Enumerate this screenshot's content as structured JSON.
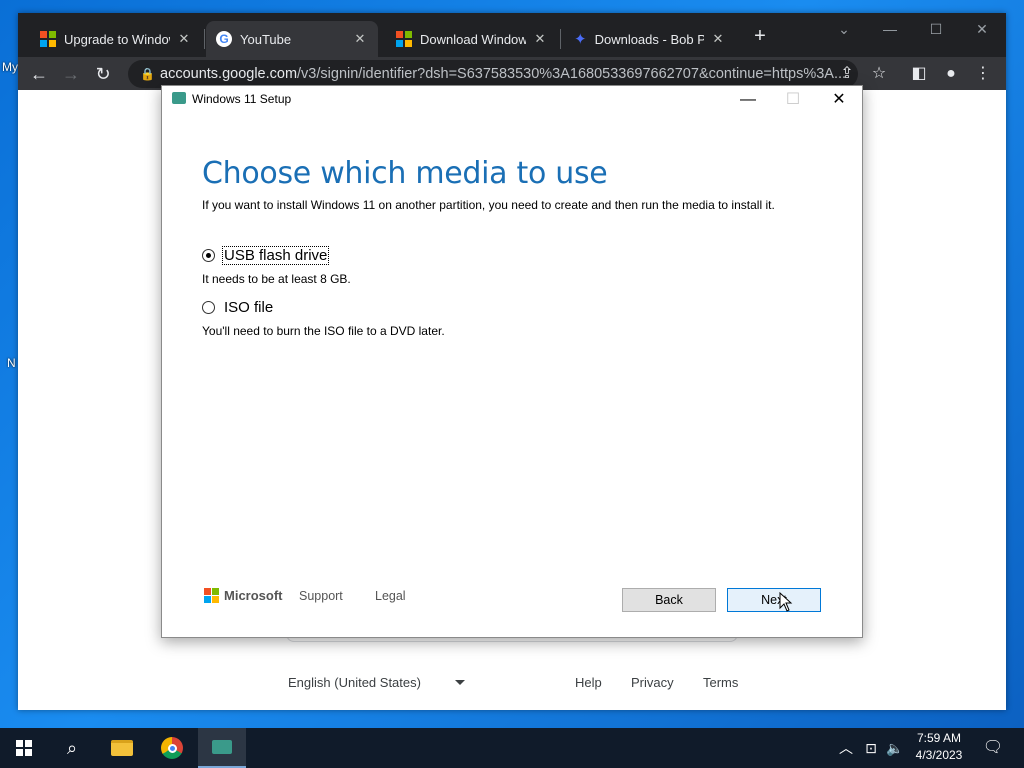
{
  "desktop": {
    "fragments": [
      "My",
      "N"
    ]
  },
  "browser": {
    "tabs": [
      {
        "title": "Upgrade to Windows",
        "icon": "microsoft-icon",
        "active": false
      },
      {
        "title": "YouTube",
        "icon": "google-icon",
        "active": true
      },
      {
        "title": "Download Windows",
        "icon": "microsoft-icon",
        "active": false
      },
      {
        "title": "Downloads - Bob Po",
        "icon": "puzzle-icon",
        "active": false
      }
    ],
    "new_tab_label": "+",
    "url_host": "accounts.google.com",
    "url_path": "/v3/signin/identifier?dsh=S637583530%3A1680533697662707&continue=https%3A...",
    "page_footer": {
      "language": "English (United States)",
      "links": [
        "Help",
        "Privacy",
        "Terms"
      ]
    }
  },
  "setup_dialog": {
    "title": "Windows 11 Setup",
    "heading": "Choose which media to use",
    "subtitle": "If you want to install Windows 11 on another partition, you need to create and then run the media to install it.",
    "options": [
      {
        "label": "USB flash drive",
        "description": "It needs to be at least 8 GB.",
        "selected": true
      },
      {
        "label": "ISO file",
        "description": "You'll need to burn the ISO file to a DVD later.",
        "selected": false
      }
    ],
    "brand": "Microsoft",
    "links": {
      "support": "Support",
      "legal": "Legal"
    },
    "buttons": {
      "back": "Back",
      "next": "Next"
    }
  },
  "taskbar": {
    "time": "7:59 AM",
    "date": "4/3/2023"
  },
  "colors": {
    "heading_blue": "#1a6fb5",
    "chrome_dark": "#202124",
    "desktop_blue": "#0a6fd6",
    "next_button_border": "#0078d7"
  }
}
